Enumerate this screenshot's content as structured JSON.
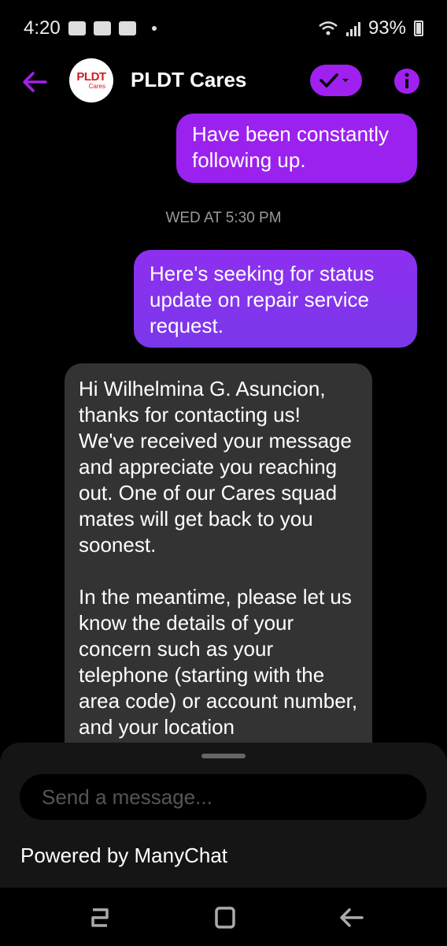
{
  "status_bar": {
    "time": "4:20",
    "battery": "93%"
  },
  "header": {
    "title": "PLDT Cares",
    "avatar_text": "PLDT",
    "avatar_subtext": "Cares"
  },
  "messages": [
    {
      "text": "Have been constantly following up."
    },
    {
      "text": "Here's seeking for status update on repair  service request."
    },
    {
      "paragraphs": [
        "Hi Wilhelmina G. Asuncion, thanks for contacting us! We've received your message and appreciate you reaching out. One of our Cares squad mates will get back to you soonest.",
        "In the meantime, please let us know the details of your concern such as your telephone (starting with the area code) or account number, and your location"
      ]
    }
  ],
  "timestamp": "WED AT 5:30 PM",
  "composer": {
    "placeholder": "Send a message..."
  },
  "footer": {
    "powered_by": "Powered by ManyChat"
  },
  "colors": {
    "accent": "#a020f0",
    "bubble_out": "#9b22ee",
    "bubble_in": "#333333"
  }
}
